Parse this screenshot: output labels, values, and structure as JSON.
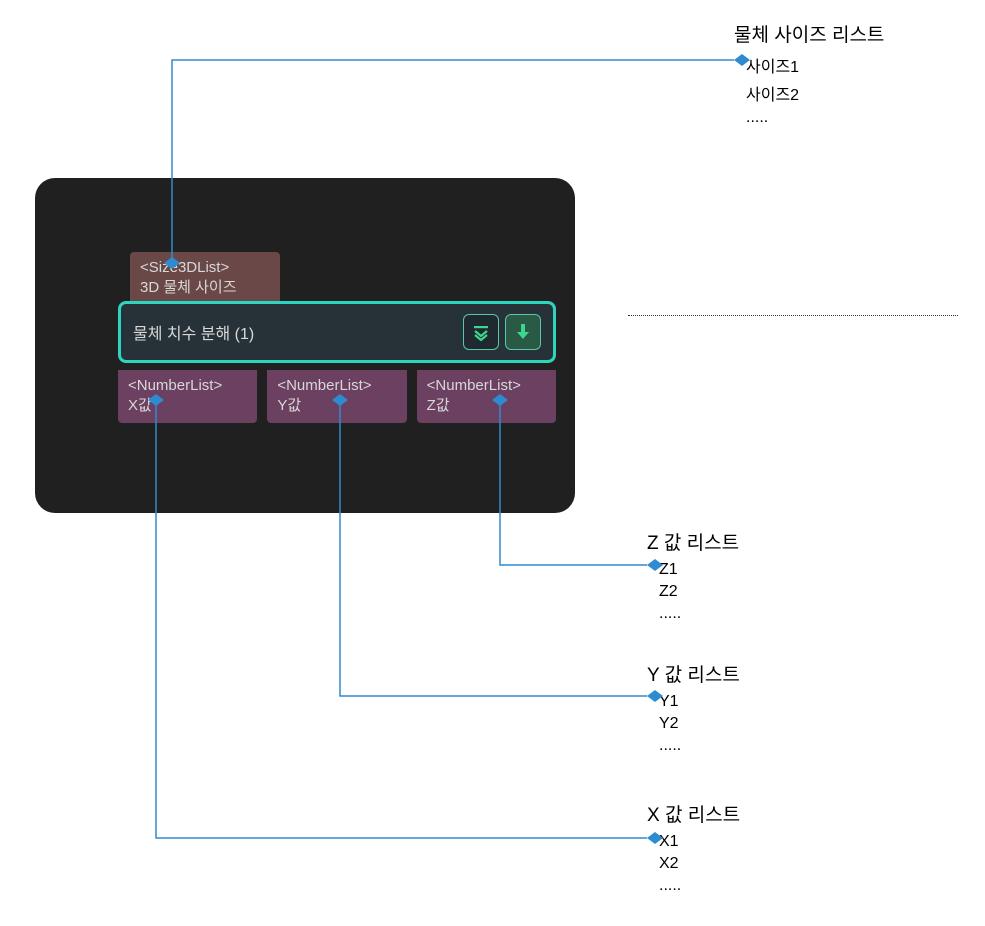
{
  "panel": {
    "input_node": {
      "type_label": "<Size3DList>",
      "name": "3D 물체 사이즈"
    },
    "main_node": {
      "title": "물체 치수 분해 (1)"
    },
    "outputs": {
      "x": {
        "type_label": "<NumberList>",
        "name": "X값"
      },
      "y": {
        "type_label": "<NumberList>",
        "name": "Y값"
      },
      "z": {
        "type_label": "<NumberList>",
        "name": "Z값"
      }
    }
  },
  "annotations": {
    "size_list": {
      "title": "물체 사이즈 리스트",
      "items": [
        "사이즈1",
        "사이즈2",
        "....."
      ]
    },
    "z_list": {
      "title": "Z 값 리스트",
      "items": [
        "Z1",
        "Z2",
        "....."
      ]
    },
    "y_list": {
      "title": "Y 값 리스트",
      "items": [
        "Y1",
        "Y2",
        "....."
      ]
    },
    "x_list": {
      "title": "X 값 리스트",
      "items": [
        "X1",
        "X2",
        "....."
      ]
    }
  }
}
